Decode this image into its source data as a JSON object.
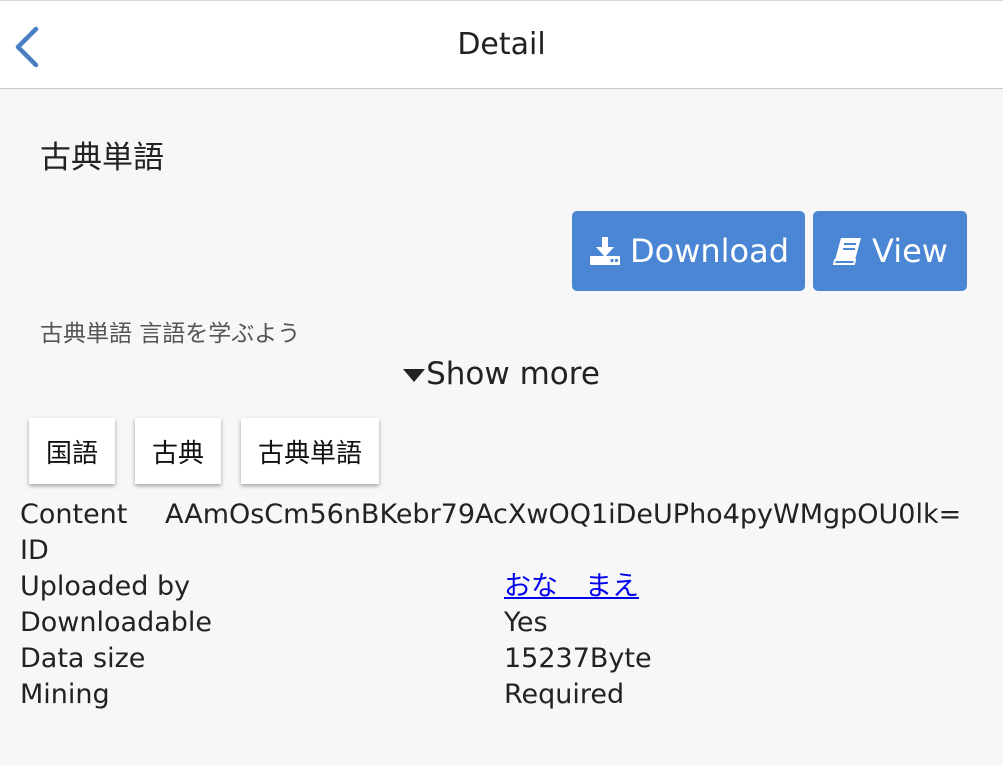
{
  "header": {
    "title": "Detail",
    "back_icon": "chevron-left-icon"
  },
  "content": {
    "title": "古典単語",
    "description": "古典単語 言語を学ぶよう",
    "show_more_label": "Show more"
  },
  "actions": {
    "download_label": "Download",
    "download_icon": "download-icon",
    "view_label": "View",
    "view_icon": "book-icon",
    "button_color": "#4a86d4"
  },
  "tags": [
    "国語",
    "古典",
    "古典単語"
  ],
  "info": {
    "content_id_label_1": "Content",
    "content_id_label_2": "ID",
    "content_id_value": "AAmOsCm56nBKebr79AcXwOQ1iDeUPho4pyWMgpOU0lk=",
    "uploaded_by_label": "Uploaded by",
    "uploaded_by_value": "おな　まえ",
    "downloadable_label": "Downloadable",
    "downloadable_value": "Yes",
    "data_size_label": "Data size",
    "data_size_value": "15237Byte",
    "mining_label": "Mining",
    "mining_value": "Required"
  }
}
